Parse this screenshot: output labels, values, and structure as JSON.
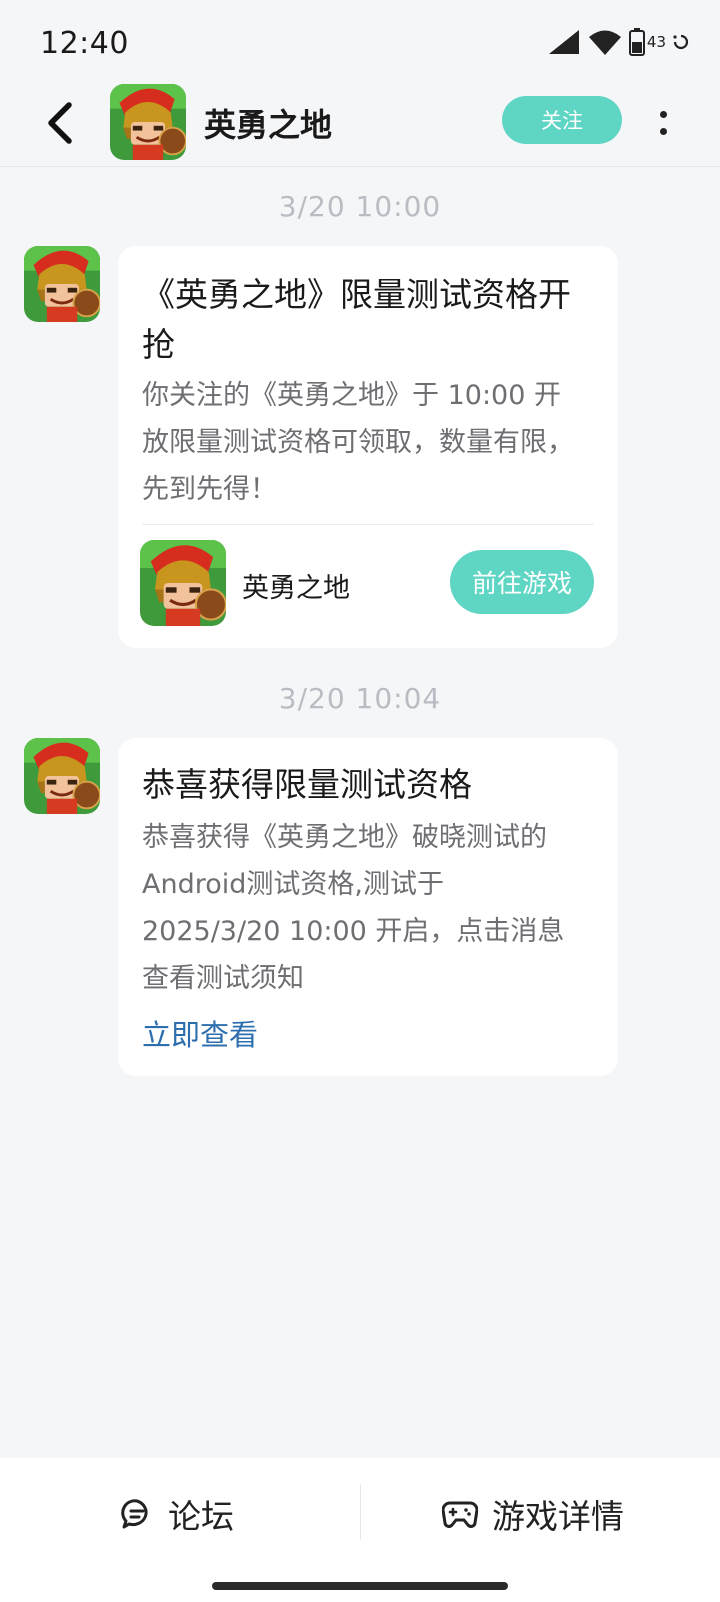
{
  "status_bar": {
    "time": "12:40",
    "battery": "43"
  },
  "header": {
    "title": "英勇之地",
    "follow_label": "关注"
  },
  "messages": [
    {
      "timestamp": "3/20  10:00",
      "title": "《英勇之地》限量测试资格开抢",
      "body": "你关注的《英勇之地》于 10:00 开放限量测试资格可领取，数量有限，先到先得！",
      "game_name": "英勇之地",
      "action_label": "前往游戏"
    },
    {
      "timestamp": "3/20  10:04",
      "title": "恭喜获得限量测试资格",
      "body": "恭喜获得《英勇之地》破晓测试的Android测试资格,测试于2025/3/20 10:00 开启，点击消息查看测试须知",
      "link_label": "立即查看"
    }
  ],
  "bottom_nav": {
    "forum_label": "论坛",
    "details_label": "游戏详情"
  },
  "colors": {
    "accent": "#5fd6c4",
    "link": "#2d6fae",
    "background": "#f5f6f8"
  }
}
